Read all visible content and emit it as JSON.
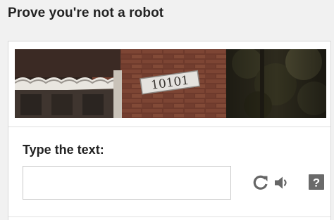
{
  "dialog": {
    "title": "Prove you're not a robot"
  },
  "captcha": {
    "image_text": "10101",
    "prompt_label": "Type the text:",
    "input_value": "",
    "input_placeholder": ""
  },
  "tools": [
    {
      "icon": "refresh-icon"
    },
    {
      "icon": "audio-icon"
    },
    {
      "icon": "help-icon"
    }
  ],
  "colors": {
    "background": "#f1f1f1",
    "card": "#ffffff",
    "text": "#222222",
    "icon": "#666666"
  }
}
